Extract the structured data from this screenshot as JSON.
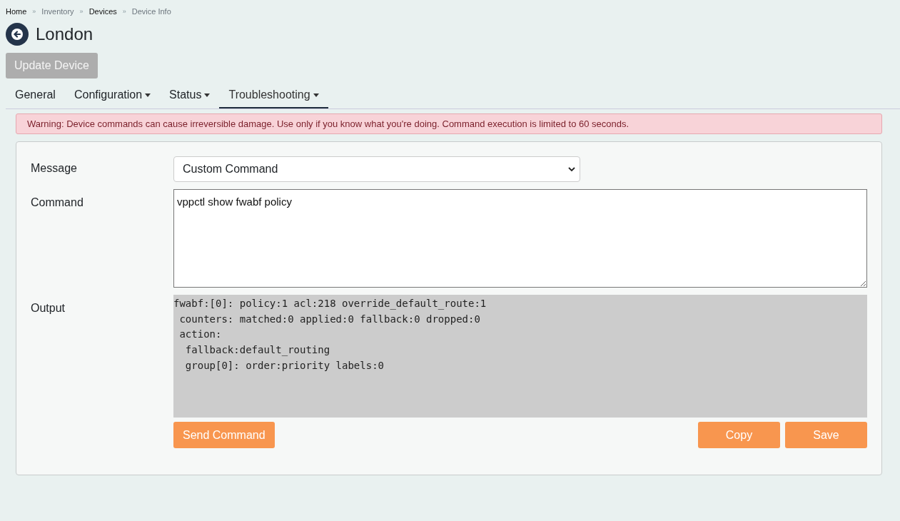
{
  "breadcrumb": [
    {
      "label": "Home",
      "link": true
    },
    {
      "label": "Inventory",
      "link": false
    },
    {
      "label": "Devices",
      "link": true
    },
    {
      "label": "Device Info",
      "link": false
    }
  ],
  "breadcrumb_separator": "»",
  "title": "London",
  "update_button": {
    "label": "Update Device",
    "disabled": true
  },
  "tabs": [
    {
      "label": "General",
      "dropdown": false,
      "selected": false
    },
    {
      "label": "Configuration",
      "dropdown": true,
      "selected": false
    },
    {
      "label": "Status",
      "dropdown": true,
      "selected": false
    },
    {
      "label": "Troubleshooting",
      "dropdown": true,
      "selected": true
    }
  ],
  "warning": "Warning: Device commands can cause irreversible damage. Use only if you know what you're doing. Command execution is limited to 60 seconds.",
  "form": {
    "message_label": "Message",
    "message_value": "Custom Command",
    "command_label": "Command",
    "command_value": "vppctl show fwabf policy",
    "output_label": "Output",
    "output_lines": [
      "fwabf:[0]: policy:1 acl:218 override_default_route:1",
      " counters: matched:0 applied:0 fallback:0 dropped:0",
      " action:",
      "  fallback:default_routing",
      "  group[0]: order:priority labels:0"
    ]
  },
  "buttons": {
    "send": "Send Command",
    "copy": "Copy",
    "save": "Save"
  }
}
